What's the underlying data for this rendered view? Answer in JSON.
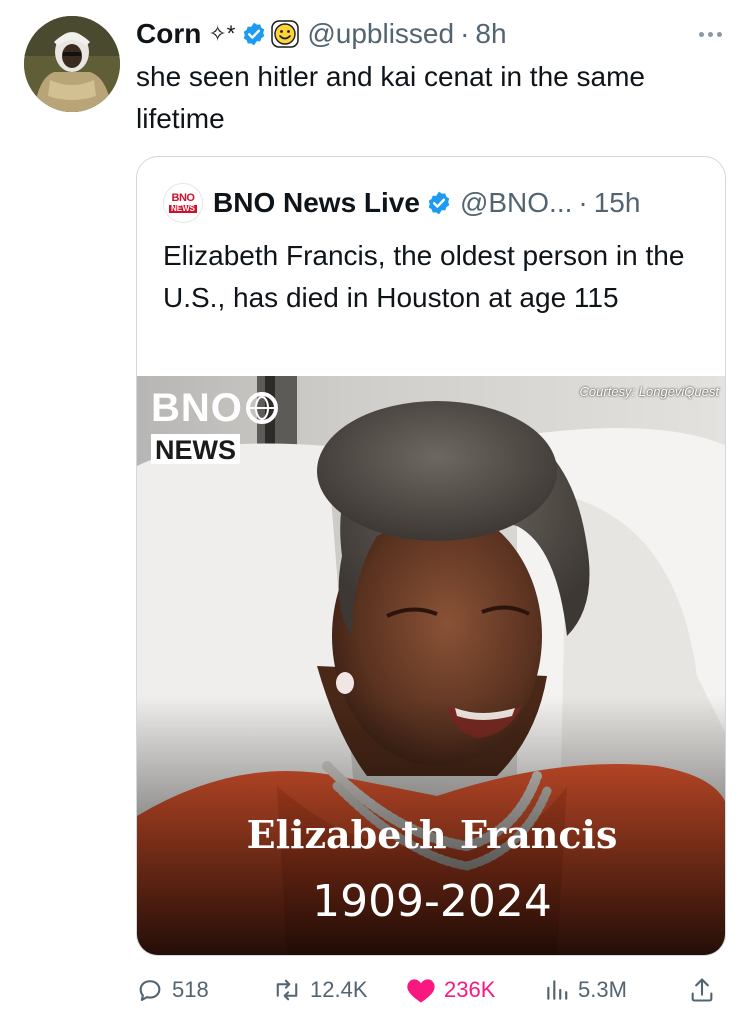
{
  "author": {
    "display_name": "Corn",
    "name_decoration": "✧*",
    "handle": "@upblissed",
    "separator": "·",
    "time": "8h"
  },
  "tweet": {
    "text": "she seen hitler and kai cenat in the same lifetime"
  },
  "quoted": {
    "logo_top": "BNO",
    "logo_bottom": "NEWS",
    "display_name": "BNO News Live",
    "handle": "@BNO...",
    "separator": "·",
    "time": "15h",
    "text": "Elizabeth Francis, the oldest person in the U.S., has died in Houston at age 115",
    "media": {
      "brand_line1": "BNO",
      "brand_line2": "NEWS",
      "credit": "Courtesy: LongeviQuest",
      "caption_name": "Elizabeth Francis",
      "caption_years": "1909-2024"
    }
  },
  "actions": {
    "replies": "518",
    "retweets": "12.4K",
    "likes": "236K",
    "views": "5.3M"
  },
  "colors": {
    "verified": "#1d9bf0",
    "like": "#f91880",
    "muted": "#536471",
    "border": "#cfd9de",
    "bno_red": "#d0102b"
  },
  "icons": [
    "verified-badge-icon",
    "smiley-emoji-icon",
    "more-icon",
    "reply-icon",
    "retweet-icon",
    "like-icon",
    "views-icon",
    "share-icon",
    "globe-icon"
  ]
}
